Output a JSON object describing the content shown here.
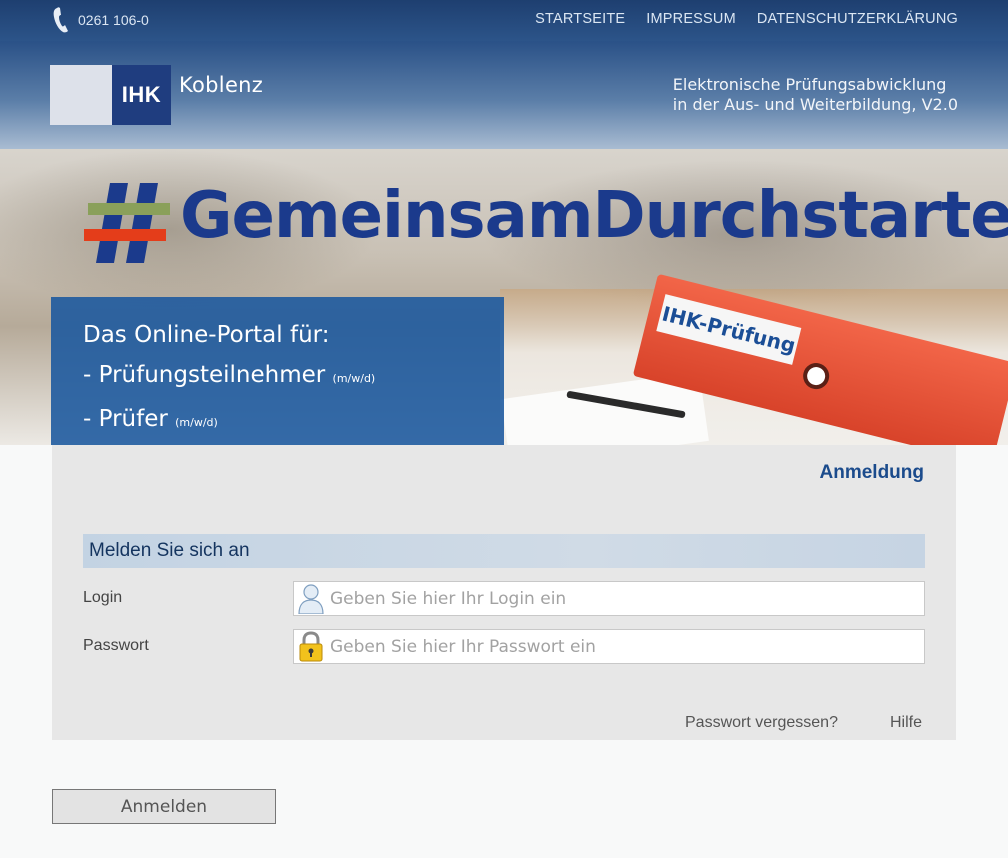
{
  "topbar": {
    "phone": "0261 106-0",
    "nav": [
      "STARTSEITE",
      "IMPRESSUM",
      "DATENSCHUTZERKLÄRUNG"
    ]
  },
  "header": {
    "logo_short": "IHK",
    "logo_name": "Koblenz",
    "tagline_line1": "Elektronische Prüfungsabwicklung",
    "tagline_line2": "in der Aus- und Weiterbildung, V2.0"
  },
  "banner": {
    "hashtag": "GemeinsamDurchstarten",
    "portal_line1": "Das Online-Portal für:",
    "portal_line2": "- Prüfungsteilnehmer",
    "portal_line2_suffix": "(m/w/d)",
    "portal_line3": "- Prüfer",
    "portal_line3_suffix": "(m/w/d)",
    "binder_label": "IHK-Prüfung"
  },
  "login": {
    "title": "Anmeldung",
    "section": "Melden Sie sich an",
    "login_label": "Login",
    "login_placeholder": "Geben Sie hier Ihr Login ein",
    "login_icon": "user-icon",
    "password_label": "Passwort",
    "password_placeholder": "Geben Sie hier Ihr Passwort ein",
    "password_icon": "lock-icon",
    "forgot": "Passwort vergessen?",
    "help": "Hilfe",
    "submit": "Anmelden"
  },
  "colors": {
    "brand_blue": "#1b3a8c",
    "topbar": "#1e3f70",
    "portal_box": "#1a589e"
  }
}
